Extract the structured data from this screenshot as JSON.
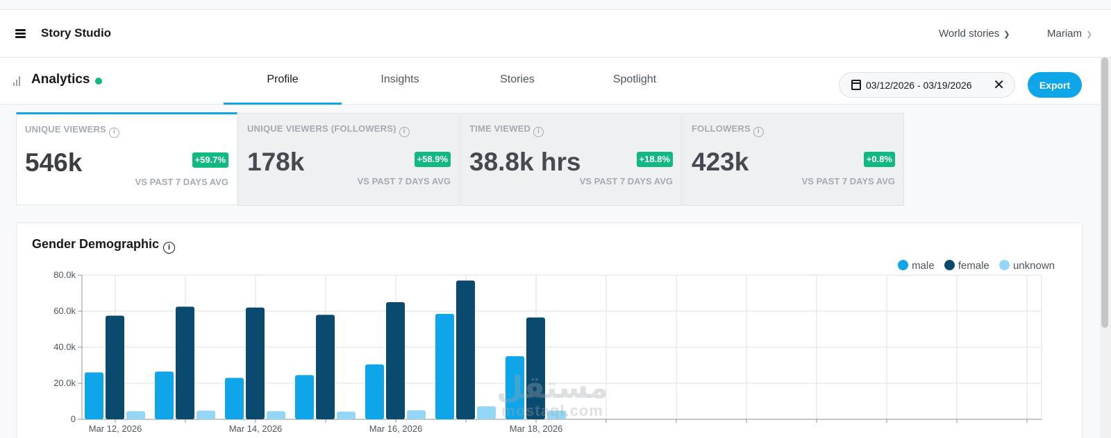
{
  "header": {
    "title": "Story Studio",
    "world_dropdown": "World stories",
    "user_dropdown": "Mariam"
  },
  "subheader": {
    "title": "Analytics",
    "tabs": [
      {
        "label": "Profile",
        "active": true
      },
      {
        "label": "Insights",
        "active": false
      },
      {
        "label": "Stories",
        "active": false
      },
      {
        "label": "Spotlight",
        "active": false
      }
    ],
    "date_range": "03/12/2026 - 03/19/2026",
    "export_label": "Export"
  },
  "metrics": [
    {
      "label": "UNIQUE VIEWERS",
      "value": "546k",
      "change": "+59.7%",
      "sub": "VS PAST 7 DAYS AVG",
      "active": true
    },
    {
      "label": "UNIQUE VIEWERS (FOLLOWERS)",
      "value": "178k",
      "change": "+58.9%",
      "sub": "VS PAST 7 DAYS AVG",
      "active": false
    },
    {
      "label": "TIME VIEWED",
      "value": "38.8k hrs",
      "change": "+18.8%",
      "sub": "VS PAST 7 DAYS AVG",
      "active": false
    },
    {
      "label": "FOLLOWERS",
      "value": "423k",
      "change": "+0.8%",
      "sub": "VS PAST 7 DAYS AVG",
      "active": false
    }
  ],
  "chart_panel": {
    "title": "Gender Demographic"
  },
  "colors": {
    "accent": "#0ea5e9",
    "positive": "#10b981",
    "male": "#0ea5e9",
    "female": "#0b4a6f",
    "unknown": "#93d6f5"
  },
  "watermark": {
    "main": "مستقل",
    "sub": "mostaql.com"
  },
  "chart_data": {
    "type": "bar",
    "title": "Gender Demographic",
    "x_tick_labels": [
      "Mar 12, 2026",
      "Mar 14, 2026",
      "Mar 16, 2026",
      "Mar 18, 2026"
    ],
    "categories": [
      "Mar 12, 2026",
      "Mar 13, 2026",
      "Mar 14, 2026",
      "Mar 15, 2026",
      "Mar 16, 2026",
      "Mar 17, 2026",
      "Mar 18, 2026"
    ],
    "y_ticks": [
      "0",
      "20.0k",
      "40.0k",
      "60.0k",
      "80.0k"
    ],
    "ylim": [
      0,
      80000
    ],
    "grid": true,
    "legend_position": "top-right",
    "series": [
      {
        "name": "male",
        "values": [
          26000,
          26500,
          23000,
          24500,
          30500,
          58500,
          35000
        ]
      },
      {
        "name": "female",
        "values": [
          57500,
          62500,
          62000,
          58000,
          65000,
          77000,
          56500
        ]
      },
      {
        "name": "unknown",
        "values": [
          4500,
          4800,
          4500,
          4300,
          5000,
          7200,
          4800
        ]
      }
    ]
  }
}
